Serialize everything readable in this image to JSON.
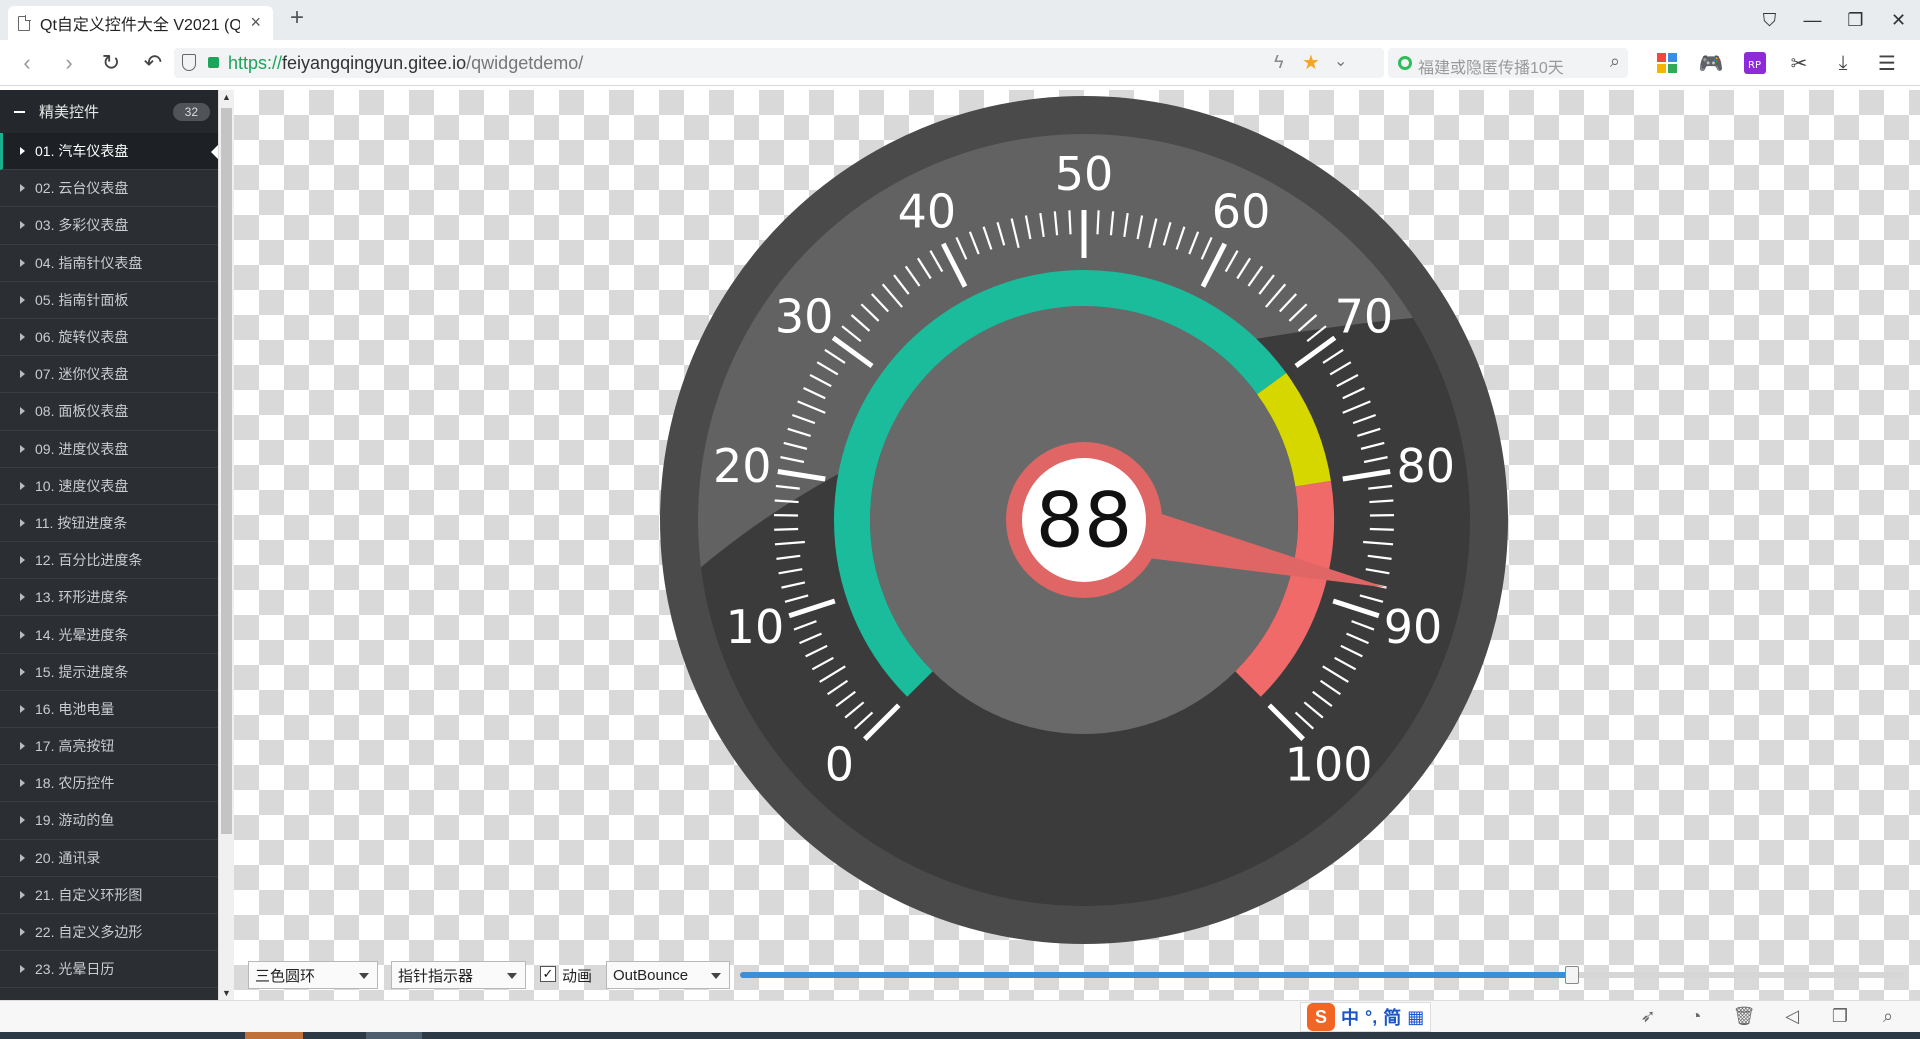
{
  "browser": {
    "tab_title": "Qt自定义控件大全 V2021 (Q",
    "tab_close": "×",
    "new_tab": "+",
    "url_scheme": "https://",
    "url_host": "feiyangqingyun.gitee.io",
    "url_path": "/qwidgetdemo/",
    "search_placeholder": "福建或隐匿传播10天"
  },
  "sidebar": {
    "group_title": "精美控件",
    "group_count": "32",
    "items": [
      "01. 汽车仪表盘",
      "02. 云台仪表盘",
      "03. 多彩仪表盘",
      "04. 指南针仪表盘",
      "05. 指南针面板",
      "06. 旋转仪表盘",
      "07. 迷你仪表盘",
      "08. 面板仪表盘",
      "09. 进度仪表盘",
      "10. 速度仪表盘",
      "11. 按钮进度条",
      "12. 百分比进度条",
      "13. 环形进度条",
      "14. 光晕进度条",
      "15. 提示进度条",
      "16. 电池电量",
      "17. 高亮按钮",
      "18. 农历控件",
      "19. 游动的鱼",
      "20. 通讯录",
      "21. 自定义环形图",
      "22. 自定义多边形",
      "23. 光晕日历"
    ]
  },
  "gauge": {
    "value": 88,
    "value_text": "88",
    "min": 0,
    "max": 100,
    "scale_labels": [
      "0",
      "10",
      "20",
      "30",
      "40",
      "50",
      "60",
      "70",
      "80",
      "90",
      "100"
    ],
    "range_split": [
      70,
      80
    ],
    "colors": {
      "outer": "#484848",
      "bezel": "#3a3a3a",
      "face": "#666666",
      "ring_low": "#1abc9c",
      "ring_mid": "#d7d700",
      "ring_high": "#f06a6a",
      "pointer": "#e06666",
      "text": "#ffffff"
    }
  },
  "controls": {
    "ring_style": "三色圆环",
    "pointer_style": "指针指示器",
    "animation_checked": true,
    "animation_label": "动画",
    "check_mark": "✓",
    "easing": "OutBounce",
    "slider_value_fraction": 0.715
  },
  "ime": {
    "logo": "S",
    "items": [
      "中",
      "°,",
      "简",
      "▦"
    ]
  }
}
